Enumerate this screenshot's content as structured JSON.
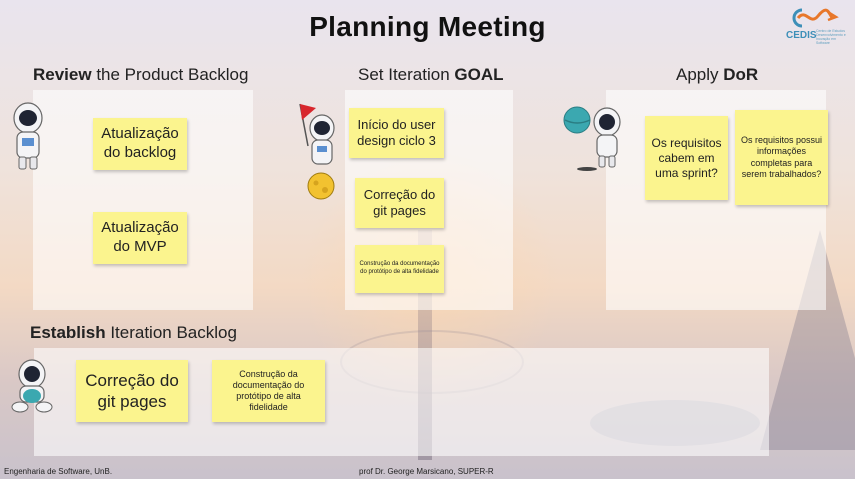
{
  "title": "Planning Meeting",
  "logo": {
    "name": "CEDIS",
    "subtitle": "Centro de Estudos Desenvolvimento e Inovação em Software"
  },
  "sections": {
    "review": {
      "bold": "Review",
      "rest": " the Product Backlog"
    },
    "goal": {
      "prefix": "Set Iteration ",
      "bold": "GOAL"
    },
    "dor": {
      "prefix": "Apply ",
      "bold": "DoR"
    },
    "establish": {
      "bold": "Establish",
      "rest": " Iteration Backlog"
    }
  },
  "notes": {
    "review_1": "Atualização do backlog",
    "review_2": "Atualização do MVP",
    "goal_1": "Início do user design ciclo 3",
    "goal_2": "Correção do git pages",
    "goal_3": "Construção da documentação do protótipo de alta fidelidade",
    "dor_1": "Os requisitos cabem em uma sprint?",
    "dor_2": "Os requisitos possui informações completas para serem trabalhados?",
    "backlog_1": "Correção do git pages",
    "backlog_2": "Construção da documentação do protótipo de alta fidelidade"
  },
  "footer": {
    "left": "Engenharia de Software, UnB.",
    "center": "prof Dr. George Marsicano, SUPER-R"
  },
  "colors": {
    "sticky": "#fbf48e",
    "logo": "#3d8fb8",
    "logo_accent": "#e8772a"
  }
}
